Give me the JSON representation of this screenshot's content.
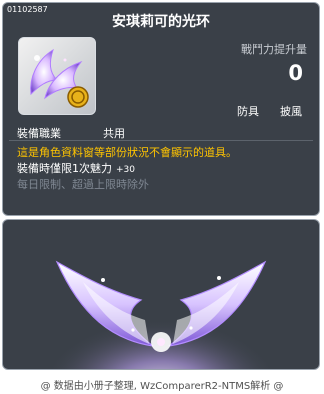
{
  "item_id": "01102587",
  "title": "安琪莉可的光环",
  "stats": {
    "label": "戰鬥力提升量",
    "value": "0"
  },
  "chips": {
    "armor": "防具",
    "cape": "披風"
  },
  "job": {
    "label": "裝備職業",
    "value": "共用"
  },
  "description": "這是角色資料窗等部份狀況不會顯示的道具。",
  "equip_bonus": {
    "text": "裝備時僅限1次魅力",
    "value": "+30"
  },
  "limit_text": "每日限制、超過上限時除外",
  "footer": "@ 数据由小册子整理, WzComparerR2-NTMS解析 @",
  "icons": {
    "item": "angel-wings-icon",
    "coin": "gold-coin-icon",
    "preview": "angel-wings-preview"
  },
  "colors": {
    "panel": "#3a4048",
    "accent_gold": "#ffc400",
    "muted": "#7f8792"
  }
}
